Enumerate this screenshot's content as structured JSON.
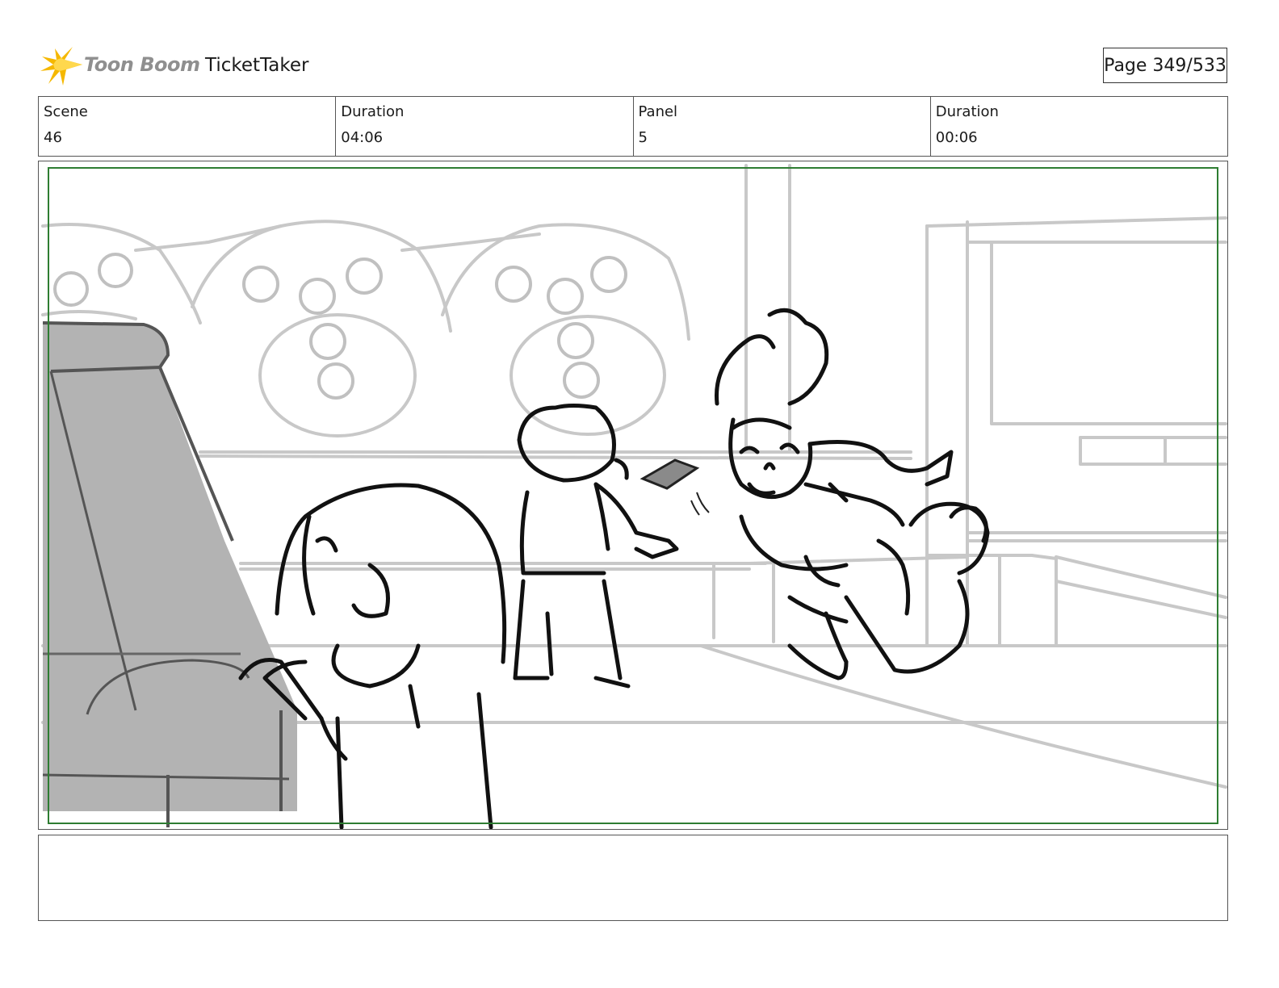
{
  "header": {
    "logo_text": "Toon Boom",
    "project_title": "TicketTaker",
    "page_label": "Page 349/533"
  },
  "info": [
    {
      "label": "Scene",
      "value": "46"
    },
    {
      "label": "Duration",
      "value": "04:06"
    },
    {
      "label": "Panel",
      "value": "5"
    },
    {
      "label": "Duration",
      "value": "00:06"
    }
  ],
  "notes": {
    "text": ""
  },
  "colors": {
    "logo_star": "#f5b800",
    "safe_frame": "#2e7d32",
    "sketch_line": "#111111",
    "background_line": "#c8c8c8",
    "seat_fill": "#b3b3b3"
  }
}
